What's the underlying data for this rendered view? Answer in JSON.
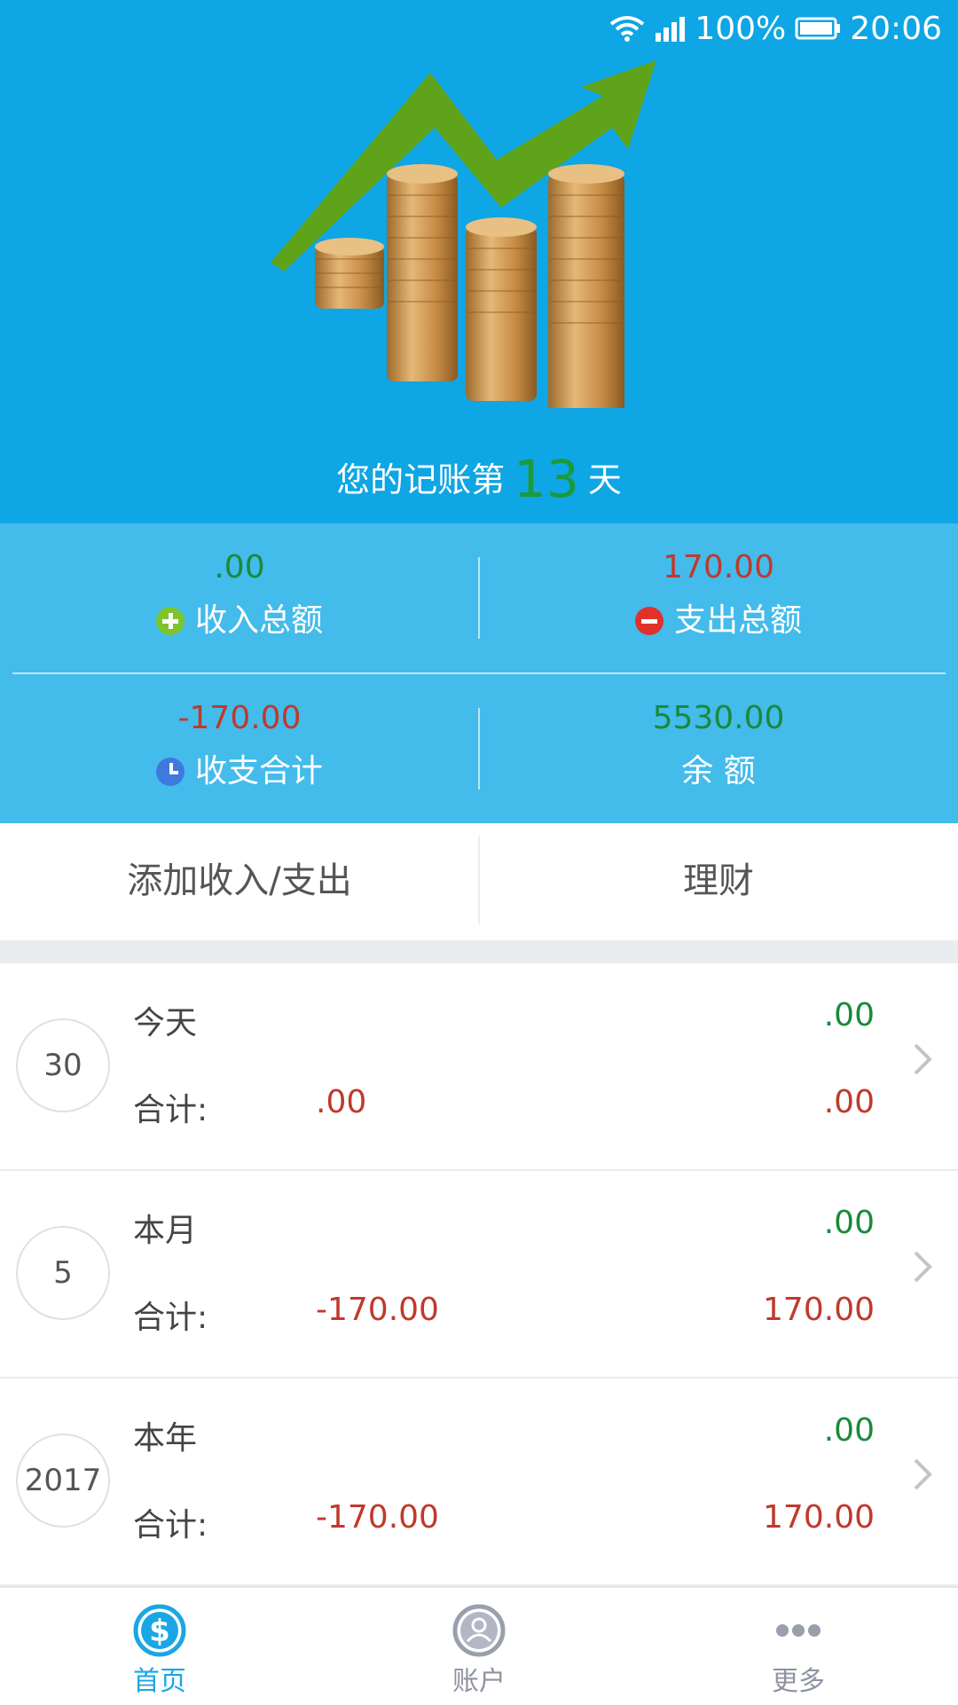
{
  "status_bar": {
    "battery": "100%",
    "time": "20:06"
  },
  "header": {
    "days_prefix": "您的记账第",
    "days_count": "13",
    "days_suffix": "天"
  },
  "summary": {
    "income_value": ".00",
    "income_label": "收入总额",
    "expense_value": "170.00",
    "expense_label": "支出总额",
    "net_value": "-170.00",
    "net_label": "收支合计",
    "balance_value": "5530.00",
    "balance_label": "余 额"
  },
  "actions": {
    "add_label": "添加收入/支出",
    "finance_label": "理财"
  },
  "periods": [
    {
      "badge": "30",
      "title": "今天",
      "sum_label": "合计:",
      "total": ".00",
      "income": ".00",
      "expense": ".00"
    },
    {
      "badge": "5",
      "title": "本月",
      "sum_label": "合计:",
      "total": "-170.00",
      "income": ".00",
      "expense": "170.00"
    },
    {
      "badge": "2017",
      "title": "本年",
      "sum_label": "合计:",
      "total": "-170.00",
      "income": ".00",
      "expense": "170.00"
    }
  ],
  "nav": [
    {
      "label": "首页",
      "icon": "dollar-icon",
      "active": true
    },
    {
      "label": "账户",
      "icon": "user-icon",
      "active": false
    },
    {
      "label": "更多",
      "icon": "more-dots-icon",
      "active": false
    }
  ],
  "colors": {
    "header_blue": "#0ea6e4",
    "summary_blue": "#43bbeb",
    "income_green": "#1a8a3a",
    "expense_red": "#c0392b",
    "nav_active": "#1aa6e4"
  }
}
